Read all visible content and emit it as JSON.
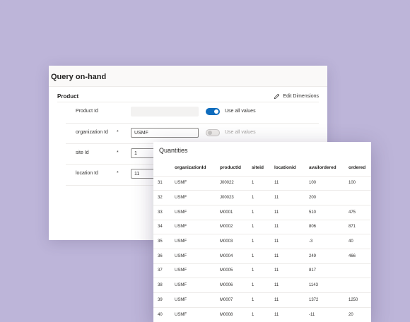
{
  "query": {
    "title": "Query on-hand",
    "section_title": "Product",
    "edit_label": "Edit Dimensions",
    "fields": [
      {
        "label": "Product Id",
        "required": "",
        "value": "",
        "toggle_label": "Use all values"
      },
      {
        "label": "organization Id",
        "required": "*",
        "value": "USMF",
        "toggle_label": "Use all values"
      },
      {
        "label": "site Id",
        "required": "*",
        "value": "1"
      },
      {
        "label": "location Id",
        "required": "*",
        "value": "11"
      }
    ]
  },
  "quantities": {
    "title": "Quantities",
    "columns": [
      "",
      "organizationId",
      "productId",
      "siteid",
      "locationid",
      "availordered",
      "ordered"
    ],
    "rows": [
      [
        "31",
        "USMF",
        "J00022",
        "1",
        "11",
        "100",
        "100"
      ],
      [
        "32",
        "USMF",
        "J00023",
        "1",
        "11",
        "200",
        ""
      ],
      [
        "33",
        "USMF",
        "M0001",
        "1",
        "11",
        "510",
        "475"
      ],
      [
        "34",
        "USMF",
        "M0002",
        "1",
        "11",
        "806",
        "871"
      ],
      [
        "35",
        "USMF",
        "M0003",
        "1",
        "11",
        "-3",
        "40"
      ],
      [
        "36",
        "USMF",
        "M0004",
        "1",
        "11",
        "249",
        "466"
      ],
      [
        "37",
        "USMF",
        "M0005",
        "1",
        "11",
        "817",
        ""
      ],
      [
        "38",
        "USMF",
        "M0006",
        "1",
        "11",
        "1143",
        ""
      ],
      [
        "39",
        "USMF",
        "M0007",
        "1",
        "11",
        "1372",
        "1250"
      ],
      [
        "40",
        "USMF",
        "M0008",
        "1",
        "11",
        "-11",
        "20"
      ]
    ]
  },
  "colors": {
    "background": "#bdb5d9",
    "toggle_on": "#0f6cbd"
  }
}
